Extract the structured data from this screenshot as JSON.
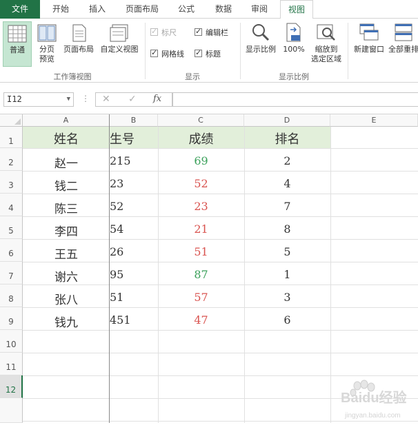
{
  "tabs": [
    "文件",
    "开始",
    "插入",
    "页面布局",
    "公式",
    "数据",
    "审阅",
    "视图"
  ],
  "ribbon": {
    "workbook_views": {
      "group_label": "工作簿视图",
      "normal": "普通",
      "page_break_l1": "分页",
      "page_break_l2": "预览",
      "page_layout": "页面布局",
      "custom_views": "自定义视图"
    },
    "show": {
      "group_label": "显示",
      "ruler": "标尺",
      "formula_bar": "编辑栏",
      "gridlines": "网格线",
      "headings": "标题"
    },
    "zoom": {
      "group_label": "显示比例",
      "zoom": "显示比例",
      "zoom100": "100%",
      "zoom_sel_l1": "缩放到",
      "zoom_sel_l2": "选定区域"
    },
    "window": {
      "new_window": "新建窗口",
      "arrange_all": "全部重排"
    }
  },
  "formula_bar": {
    "name_box": "I12",
    "cancel_glyph": "✕",
    "enter_glyph": "✓",
    "fx_glyph": "fx",
    "formula": ""
  },
  "sheet": {
    "columns": [
      "A",
      "B",
      "C",
      "D",
      "E"
    ],
    "rows": [
      "1",
      "2",
      "3",
      "4",
      "5",
      "6",
      "7",
      "8",
      "9",
      "10",
      "11",
      "12"
    ],
    "selected_row": "12",
    "header_row": [
      "姓名",
      "生号",
      "成绩",
      "排名"
    ],
    "data": [
      {
        "name": "赵一",
        "id": "215",
        "score": "69",
        "rank": "2",
        "pass": true
      },
      {
        "name": "钱二",
        "id": "23",
        "score": "52",
        "rank": "4",
        "pass": false
      },
      {
        "name": "陈三",
        "id": "52",
        "score": "23",
        "rank": "7",
        "pass": false
      },
      {
        "name": "李四",
        "id": "54",
        "score": "21",
        "rank": "8",
        "pass": false
      },
      {
        "name": "王五",
        "id": "26",
        "score": "51",
        "rank": "5",
        "pass": false
      },
      {
        "name": "谢六",
        "id": "95",
        "score": "87",
        "rank": "1",
        "pass": true
      },
      {
        "name": "张八",
        "id": "51",
        "score": "57",
        "rank": "3",
        "pass": false
      },
      {
        "name": "钱九",
        "id": "451",
        "score": "47",
        "rank": "6",
        "pass": false
      }
    ]
  },
  "colors": {
    "excel_green": "#217346",
    "header_fill": "#e2efda",
    "pass_green": "#3aa05a",
    "fail_red": "#d9534f"
  },
  "watermark": {
    "brand": "Baidu经验",
    "url": "jingyan.baidu.com"
  }
}
